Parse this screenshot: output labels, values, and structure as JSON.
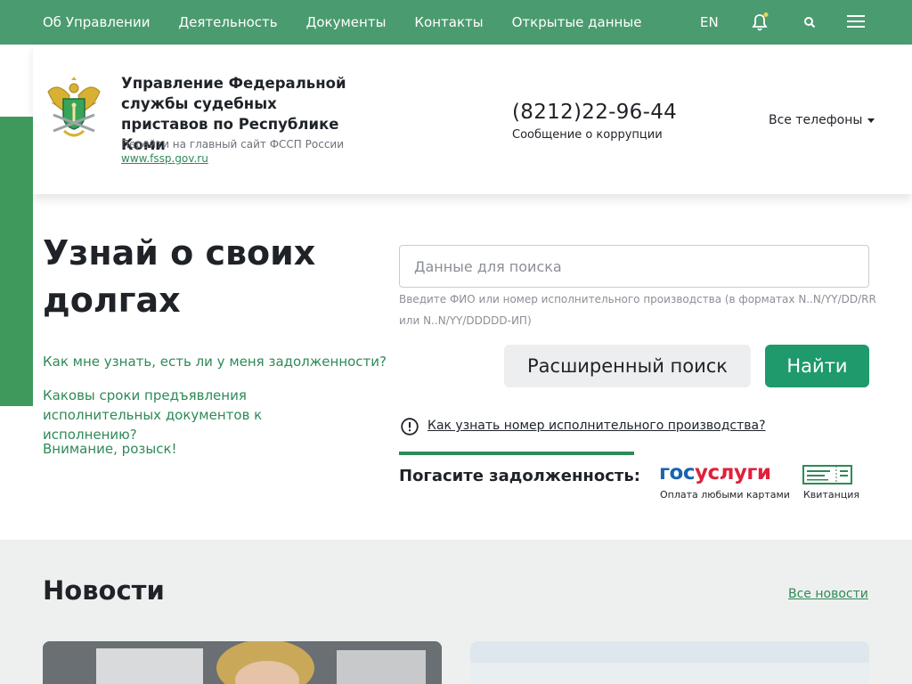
{
  "topnav": {
    "items": [
      "Об Управлении",
      "Деятельность",
      "Документы",
      "Контакты",
      "Открытые данные"
    ],
    "lang": "EN",
    "icons": [
      "bell-icon",
      "search-icon",
      "menu-icon"
    ],
    "notification_dot_color": "#f2d14b"
  },
  "header": {
    "org_title": "Управление Федеральной службы судебных приставов по Республике Коми",
    "goto_main": "Перейти на главный сайт ФССП России",
    "main_link": "www.fssp.gov.ru",
    "phone": "(8212)22-96-44",
    "corruption": "Сообщение о коррупции",
    "all_phones": "Все телефоны"
  },
  "debt": {
    "title": "Узнай о своих долгах",
    "faq": [
      "Как мне узнать, есть ли у меня задолженности?",
      "Каковы сроки предъявления исполнительных документов к исполнению?",
      "Внимание, розыск!"
    ],
    "search_placeholder": "Данные для поиска",
    "hint": "Введите ФИО или номер исполнительного производства (в форматах N..N/YY/DD/RR или N..N/YY/DDDDD-ИП)",
    "advanced_search": "Расширенный поиск",
    "find": "Найти",
    "how_to_find_number": "Как узнать номер исполнительного производства?",
    "pay_label": "Погасите задолженность:",
    "gosuslugi_a": "гос",
    "gosuslugi_b": "услуги",
    "gosuslugi_sub": "Оплата любыми картами",
    "receipt_sub": "Квитанция"
  },
  "news": {
    "title": "Новости",
    "all_news": "Все новости"
  },
  "colors": {
    "nav_green": "#4a9b6f",
    "accent_green": "#1e9a6c",
    "link_green": "#2e8a57"
  }
}
